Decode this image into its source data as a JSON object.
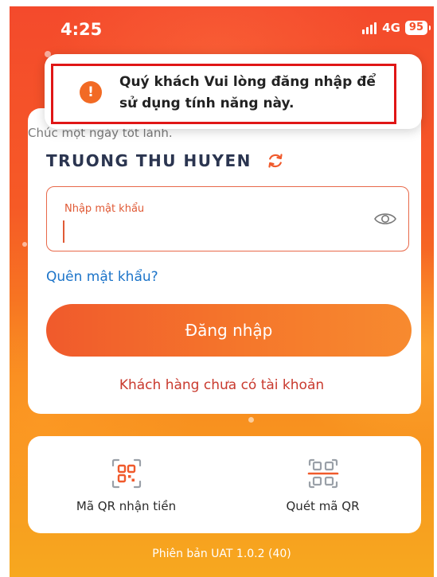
{
  "status_bar": {
    "time": "4:25",
    "network": "4G",
    "battery": "95"
  },
  "toast": {
    "message": "Quý khách Vui lòng đăng nhập để sử dụng tính năng này."
  },
  "login": {
    "greeting": "Chúc một ngày tốt lành.",
    "username": "TRUONG THU HUYEN",
    "password_label": "Nhập mật khẩu",
    "password_value": "",
    "forgot_label": "Quên mật khẩu?",
    "login_button": "Đăng nhập",
    "no_account_label": "Khách hàng chưa có tài khoản"
  },
  "quick_actions": {
    "qr_receive_label": "Mã QR nhận tiền",
    "scan_qr_label": "Quét mã QR"
  },
  "footer": {
    "version": "Phiên bản UAT 1.0.2 (40)"
  },
  "colors": {
    "accent": "#f05a2c",
    "link": "#1c74c9",
    "no_account": "#c93a2e",
    "toast_highlight": "#e01616",
    "toast_icon": "#f26a24"
  },
  "icons": {
    "switch": "refresh-icon",
    "password_toggle": "eye-icon",
    "qr_receive": "qr-code-icon",
    "scan_qr": "qr-scan-icon",
    "toast": "alert-icon"
  }
}
